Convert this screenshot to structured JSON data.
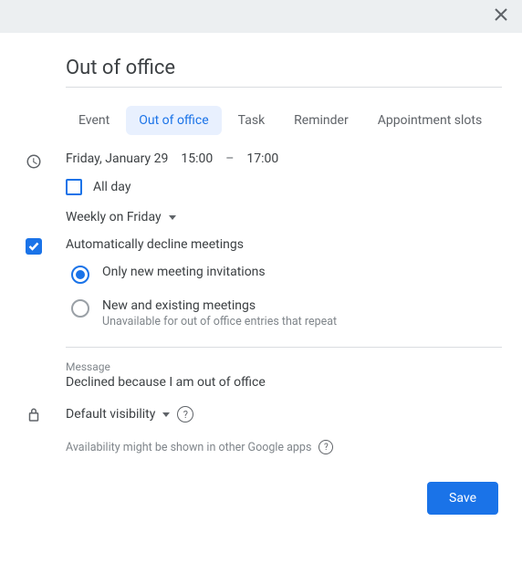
{
  "header": {
    "title": "Out of office"
  },
  "tabs": [
    {
      "label": "Event"
    },
    {
      "label": "Out of office"
    },
    {
      "label": "Task"
    },
    {
      "label": "Reminder"
    },
    {
      "label": "Appointment slots"
    }
  ],
  "datetime": {
    "date": "Friday, January 29",
    "start": "15:00",
    "separator": "–",
    "end": "17:00"
  },
  "allday": {
    "label": "All day"
  },
  "recurrence": {
    "label": "Weekly on Friday"
  },
  "decline": {
    "label": "Automatically decline meetings",
    "option1": "Only new meeting invitations",
    "option2": "New and existing meetings",
    "option2_sub": "Unavailable for out of office entries that repeat"
  },
  "message": {
    "label": "Message",
    "value": "Declined because I am out of office"
  },
  "visibility": {
    "label": "Default visibility"
  },
  "availability_note": "Availability might be shown in other Google apps",
  "footer": {
    "save": "Save"
  }
}
